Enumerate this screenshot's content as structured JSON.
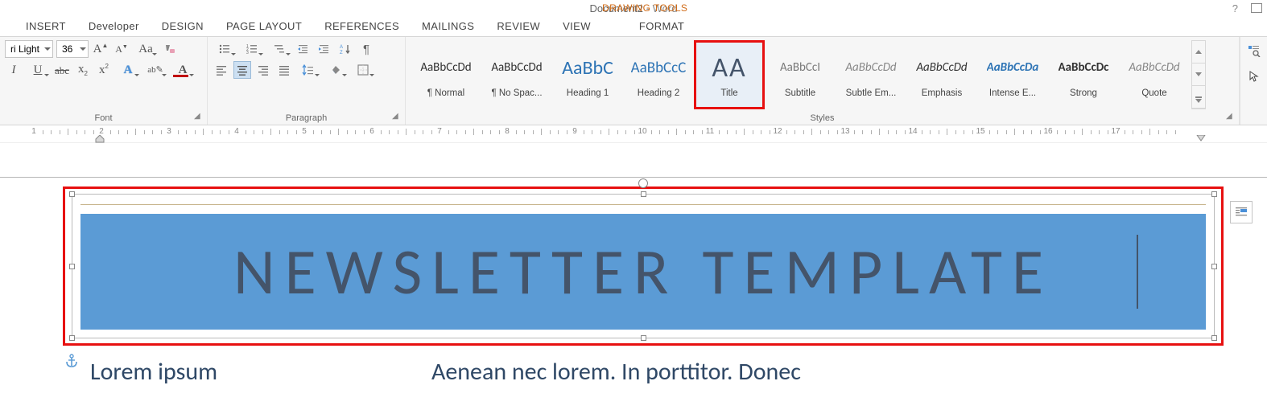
{
  "titlebar": {
    "document": "Document2",
    "app": "Word",
    "context_tab": "DRAWING TOOLS",
    "help": "?"
  },
  "tabs": [
    "INSERT",
    "Developer",
    "DESIGN",
    "PAGE LAYOUT",
    "REFERENCES",
    "MAILINGS",
    "REVIEW",
    "VIEW",
    "FORMAT"
  ],
  "font": {
    "family": "ri Light",
    "size": "36",
    "group_label": "Font"
  },
  "paragraph": {
    "group_label": "Paragraph"
  },
  "styles": {
    "group_label": "Styles",
    "items": [
      {
        "preview": "AaBbCcDd",
        "name": "¶ Normal",
        "pstyle": "font-size:15px;color:#333;"
      },
      {
        "preview": "AaBbCcDd",
        "name": "¶ No Spac...",
        "pstyle": "font-size:15px;color:#333;"
      },
      {
        "preview": "AaBbC",
        "name": "Heading 1",
        "pstyle": "font-size:24px;color:#2e74b5;"
      },
      {
        "preview": "AaBbCcC",
        "name": "Heading 2",
        "pstyle": "font-size:19px;color:#2e74b5;"
      },
      {
        "preview": "AA",
        "name": "Title",
        "pstyle": "font-size:34px;color:#44546a;letter-spacing:2px;"
      },
      {
        "preview": "AaBbCcI",
        "name": "Subtitle",
        "pstyle": "font-size:15px;color:#7a7a7a;"
      },
      {
        "preview": "AaBbCcDd",
        "name": "Subtle Em...",
        "pstyle": "font-size:15px;color:#888;font-style:italic;"
      },
      {
        "preview": "AaBbCcDd",
        "name": "Emphasis",
        "pstyle": "font-size:15px;color:#333;font-style:italic;"
      },
      {
        "preview": "AaBbCcDa",
        "name": "Intense E...",
        "pstyle": "font-size:15px;color:#2e74b5;font-style:italic;font-weight:bold;"
      },
      {
        "preview": "AaBbCcDc",
        "name": "Strong",
        "pstyle": "font-size:15px;color:#333;font-weight:bold;"
      },
      {
        "preview": "AaBbCcDd",
        "name": "Quote",
        "pstyle": "font-size:15px;color:#888;font-style:italic;"
      }
    ],
    "selected_index": 4,
    "highlight_index": 4
  },
  "ruler": {
    "start": 1,
    "end": 17
  },
  "document": {
    "banner_text": "NEWSLETTER TEMPLATE",
    "subtitle1": "Lorem ipsum",
    "subtitle2": "Aenean nec lorem. In porttitor. Donec"
  },
  "colors": {
    "font_color": "#c00000",
    "highlight_color": "#ffff00",
    "fill_color": "#444"
  }
}
